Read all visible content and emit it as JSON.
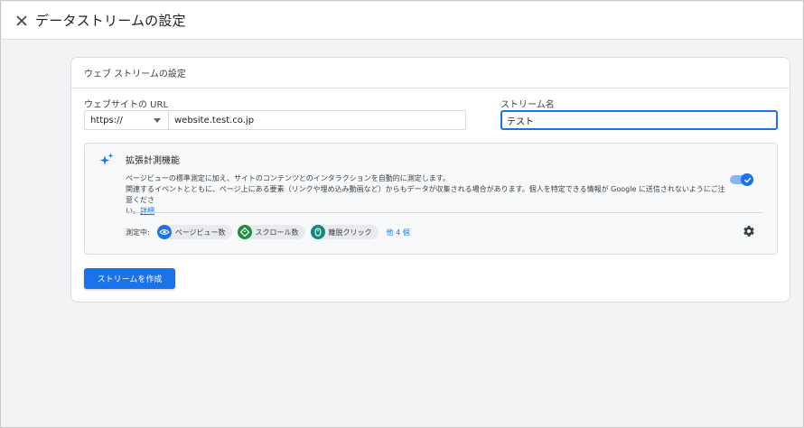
{
  "header": {
    "title": "データストリームの設定",
    "close_icon": "close-icon"
  },
  "card": {
    "header_title": "ウェブ ストリームの設定",
    "url_field": {
      "label": "ウェブサイトの URL",
      "protocol": "https://",
      "value": "website.test.co.jp"
    },
    "name_field": {
      "label": "ストリーム名",
      "value": "テスト"
    },
    "enhanced": {
      "icon": "sparkle-icon",
      "title": "拡張計測機能",
      "desc_line1": "ページビューの標準測定に加え、サイトのコンテンツとのインタラクションを自動的に測定します。",
      "desc_line2": "関連するイベントとともに、ページ上にある要素（リンクや埋め込み動画など）からもデータが収集される場合があります。個人を特定できる情報が Google に送信されないようにご注意くださ",
      "desc_line3": "い。",
      "details_link": "詳細",
      "toggle_on": true,
      "measuring_label": "測定中:",
      "chips": [
        {
          "label": "ページビュー数",
          "icon": "eye-icon",
          "color": "#1a73e8"
        },
        {
          "label": "スクロール数",
          "icon": "scroll-diamond-icon",
          "color": "#1e8e3e"
        },
        {
          "label": "離脱クリック",
          "icon": "lock-icon",
          "color": "#12897a"
        }
      ],
      "more_link": "他 4 個",
      "settings_icon": "gear-icon"
    },
    "create_button": "ストリームを作成"
  },
  "colors": {
    "accent": "#1a73e8",
    "background": "#f1f3f4"
  }
}
